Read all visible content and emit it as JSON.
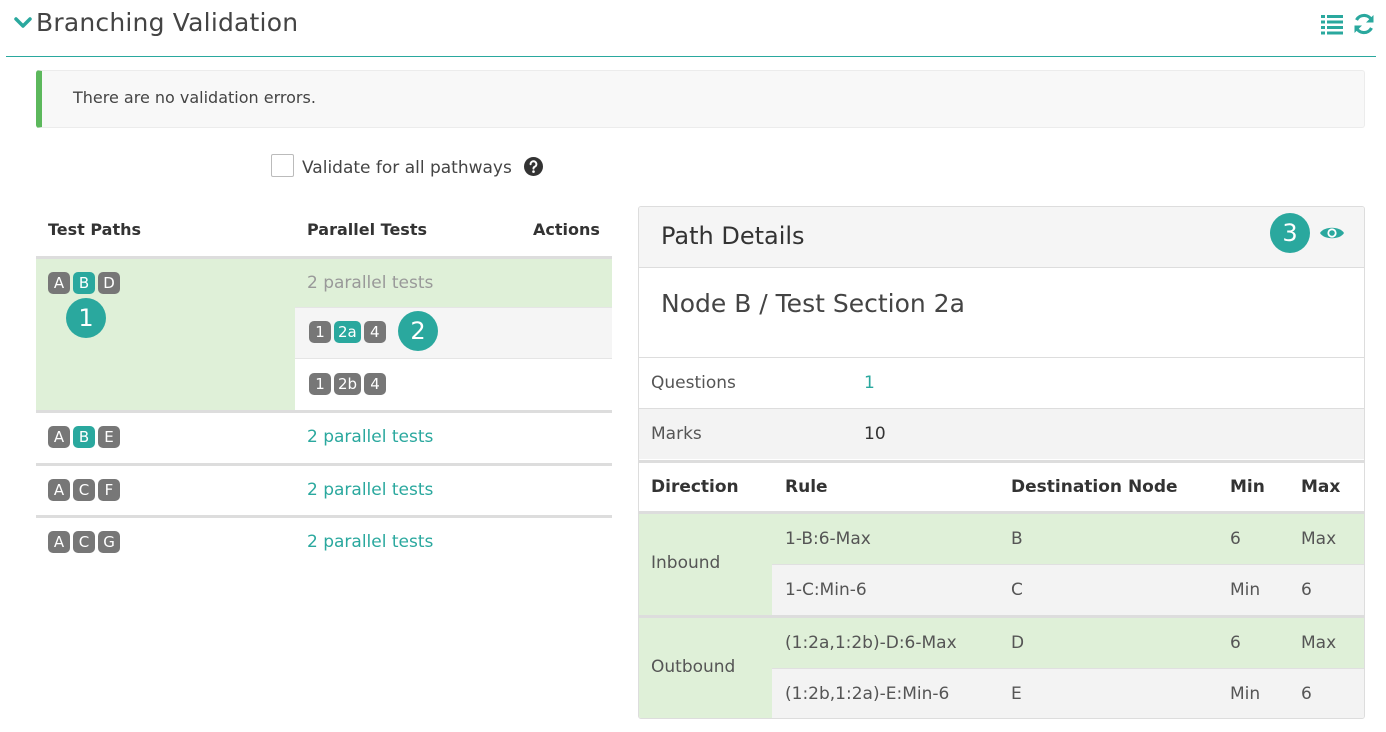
{
  "header": {
    "title": "Branching Validation"
  },
  "alert": {
    "message": "There are no validation errors."
  },
  "validate": {
    "label": "Validate for all pathways",
    "checked": false
  },
  "test_paths": {
    "headers": {
      "paths": "Test Paths",
      "parallel": "Parallel Tests",
      "actions": "Actions"
    },
    "rows": [
      {
        "nodes": [
          {
            "label": "A",
            "active": false
          },
          {
            "label": "B",
            "active": true
          },
          {
            "label": "D",
            "active": false
          }
        ],
        "parallel_label": "2 parallel tests",
        "badge": "1",
        "parallel_tests": [
          {
            "sections": [
              {
                "label": "1",
                "active": false
              },
              {
                "label": "2a",
                "active": true
              },
              {
                "label": "4",
                "active": false
              }
            ],
            "badge": "2"
          },
          {
            "sections": [
              {
                "label": "1",
                "active": false
              },
              {
                "label": "2b",
                "active": false
              },
              {
                "label": "4",
                "active": false
              }
            ]
          }
        ]
      },
      {
        "nodes": [
          {
            "label": "A",
            "active": false
          },
          {
            "label": "B",
            "active": true
          },
          {
            "label": "E",
            "active": false
          }
        ],
        "parallel_label": "2 parallel tests"
      },
      {
        "nodes": [
          {
            "label": "A",
            "active": false
          },
          {
            "label": "C",
            "active": false
          },
          {
            "label": "F",
            "active": false
          }
        ],
        "parallel_label": "2 parallel tests"
      },
      {
        "nodes": [
          {
            "label": "A",
            "active": false
          },
          {
            "label": "C",
            "active": false
          },
          {
            "label": "G",
            "active": false
          }
        ],
        "parallel_label": "2 parallel tests"
      }
    ]
  },
  "path_details": {
    "title": "Path Details",
    "badge": "3",
    "node_title": "Node B / Test Section 2a",
    "questions_label": "Questions",
    "questions_value": "1",
    "marks_label": "Marks",
    "marks_value": "10",
    "table_headers": {
      "direction": "Direction",
      "rule": "Rule",
      "destination": "Destination Node",
      "min": "Min",
      "max": "Max"
    },
    "groups": [
      {
        "direction": "Inbound",
        "rows": [
          {
            "rule": "1-B:6-Max",
            "destination": "B",
            "min": "6",
            "max": "Max"
          },
          {
            "rule": "1-C:Min-6",
            "destination": "C",
            "min": "Min",
            "max": "6"
          }
        ]
      },
      {
        "direction": "Outbound",
        "rows": [
          {
            "rule": "(1:2a,1:2b)-D:6-Max",
            "destination": "D",
            "min": "6",
            "max": "Max"
          },
          {
            "rule": "(1:2b,1:2a)-E:Min-6",
            "destination": "E",
            "min": "Min",
            "max": "6"
          }
        ]
      }
    ]
  },
  "colors": {
    "accent": "#2aa89e",
    "success_bar": "#5cb85c",
    "row_highlight": "#dff0d8",
    "chip_default": "#777777"
  },
  "icons": {
    "collapse": "chevron-down-icon",
    "list": "list-icon",
    "refresh": "refresh-icon",
    "help": "question-circle-icon",
    "view": "eye-icon"
  }
}
